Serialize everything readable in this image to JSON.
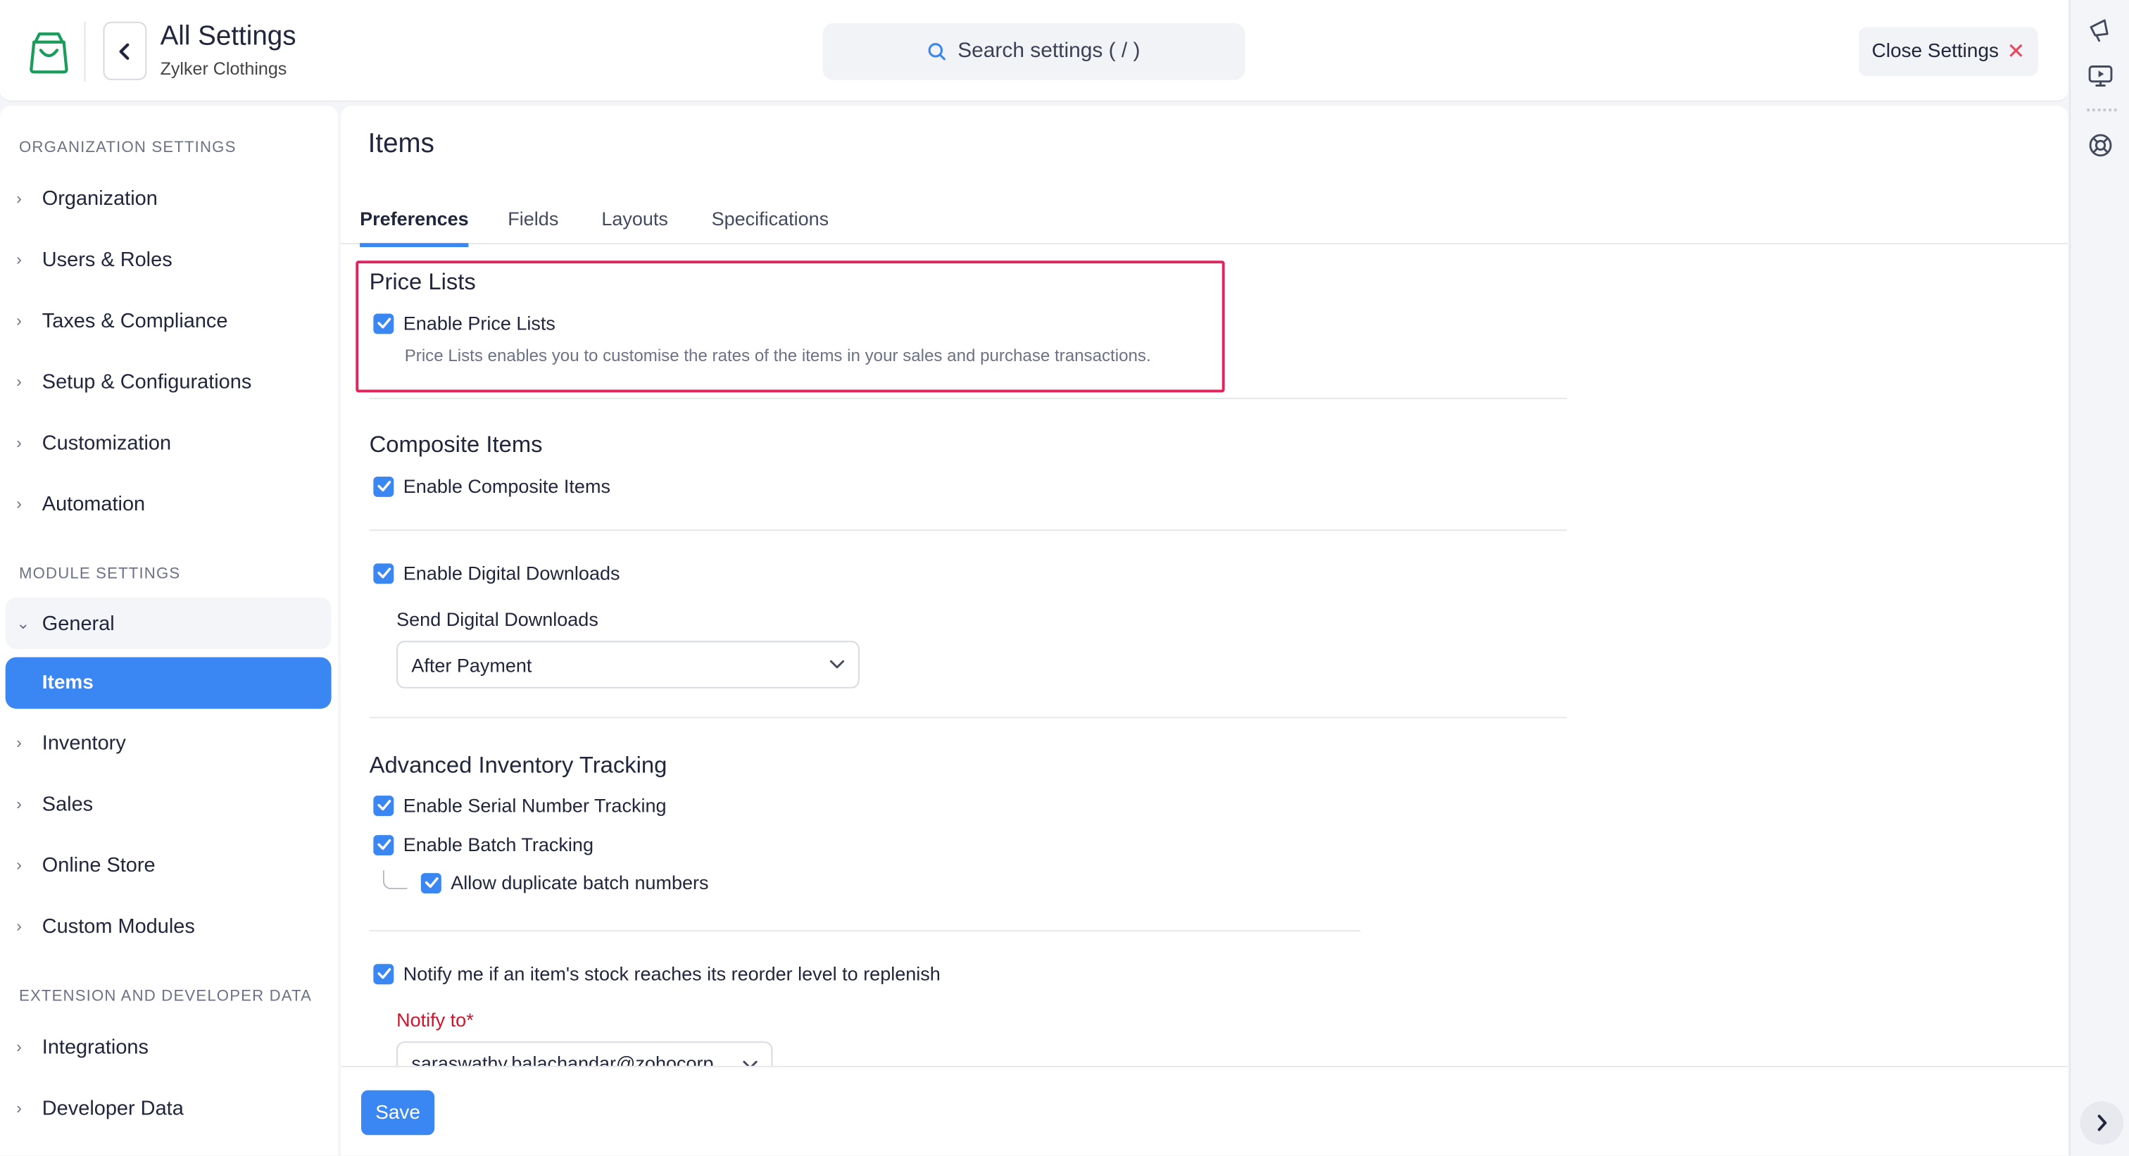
{
  "header": {
    "title": "All Settings",
    "subtitle": "Zylker Clothings",
    "search_placeholder": "Search settings ( / )",
    "close_label": "Close Settings"
  },
  "sidebar": {
    "org_section": "ORGANIZATION SETTINGS",
    "org_items": [
      "Organization",
      "Users & Roles",
      "Taxes & Compliance",
      "Setup & Configurations",
      "Customization",
      "Automation"
    ],
    "module_section": "MODULE SETTINGS",
    "general_label": "General",
    "active_item": "Items",
    "module_items": [
      "Inventory",
      "Sales",
      "Online Store",
      "Custom Modules"
    ],
    "ext_section": "EXTENSION AND DEVELOPER DATA",
    "ext_items": [
      "Integrations",
      "Developer Data"
    ]
  },
  "main": {
    "title": "Items",
    "tabs": [
      "Preferences",
      "Fields",
      "Layouts",
      "Specifications"
    ],
    "price_lists": {
      "heading": "Price Lists",
      "checkbox": "Enable Price Lists",
      "description": "Price Lists enables you to customise the rates of the items in your sales and purchase transactions."
    },
    "composite": {
      "heading": "Composite Items",
      "checkbox": "Enable Composite Items"
    },
    "digital": {
      "checkbox": "Enable Digital Downloads",
      "send_label": "Send Digital Downloads",
      "send_value": "After Payment"
    },
    "advanced": {
      "heading": "Advanced Inventory Tracking",
      "serial": "Enable Serial Number Tracking",
      "batch": "Enable Batch Tracking",
      "duplicate": "Allow duplicate batch numbers"
    },
    "notify": {
      "checkbox": "Notify me if an item's stock reaches its reorder level to replenish",
      "label": "Notify to*",
      "email": "saraswathy.balachandar@zohocorp..."
    },
    "save_label": "Save"
  },
  "colors": {
    "accent": "#3a86f3",
    "highlight_border": "#e0245e",
    "required": "#d0142c"
  }
}
